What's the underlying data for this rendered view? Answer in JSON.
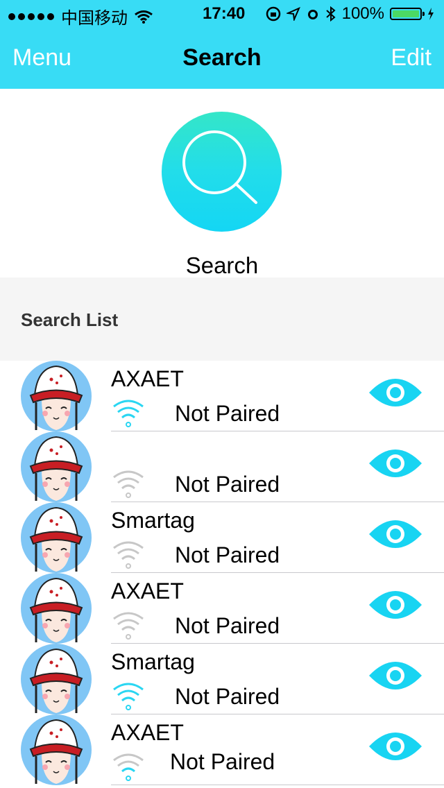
{
  "status_bar": {
    "carrier": "中国移动",
    "time": "17:40",
    "battery": "100%"
  },
  "nav": {
    "menu": "Menu",
    "title": "Search",
    "edit": "Edit"
  },
  "hero": {
    "label": "Search"
  },
  "list_header": "Search List",
  "devices": [
    {
      "name": "AXAET",
      "status": "Not Paired",
      "signal": "active"
    },
    {
      "name": "",
      "status": "Not Paired",
      "signal": "inactive"
    },
    {
      "name": "Smartag",
      "status": "Not Paired",
      "signal": "inactive"
    },
    {
      "name": "AXAET",
      "status": "Not Paired",
      "signal": "inactive"
    },
    {
      "name": "Smartag",
      "status": "Not Paired",
      "signal": "active"
    },
    {
      "name": "AXAET",
      "status": "Not Paired",
      "signal": "weak"
    }
  ],
  "colors": {
    "accent": "#38dcf5",
    "eye": "#18d4f2",
    "signal_active": "#2ad6f2",
    "signal_inactive": "#c7c7c7"
  }
}
